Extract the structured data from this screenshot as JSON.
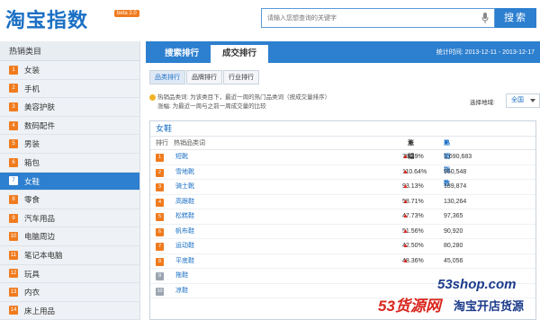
{
  "header": {
    "logo": "淘宝指数",
    "beta": "beta 2.0",
    "search_placeholder": "请输入您想查询的关键字",
    "search_button": "搜索"
  },
  "sidebar": {
    "title": "热销类目",
    "items": [
      {
        "num": "1",
        "label": "女装"
      },
      {
        "num": "2",
        "label": "手机"
      },
      {
        "num": "3",
        "label": "美容护肤"
      },
      {
        "num": "4",
        "label": "数码配件"
      },
      {
        "num": "5",
        "label": "男装"
      },
      {
        "num": "6",
        "label": "箱包"
      },
      {
        "num": "7",
        "label": "女鞋"
      },
      {
        "num": "8",
        "label": "零食"
      },
      {
        "num": "9",
        "label": "汽车用品"
      },
      {
        "num": "10",
        "label": "电脑周边"
      },
      {
        "num": "11",
        "label": "笔记本电脑"
      },
      {
        "num": "12",
        "label": "玩具"
      },
      {
        "num": "13",
        "label": "内衣"
      },
      {
        "num": "14",
        "label": "床上用品"
      }
    ],
    "active_index": 6
  },
  "main": {
    "tabs": [
      {
        "label": "搜索排行"
      },
      {
        "label": "成交排行"
      }
    ],
    "stat_time": "统计时间: 2013-12-11 - 2013-12-17",
    "subtabs": [
      {
        "label": "品类排行"
      },
      {
        "label": "品牌排行"
      },
      {
        "label": "行业排行"
      }
    ],
    "notes": {
      "line1": "热销品类词: 为该类目下，最近一周的热门品类词（按成交量排序）",
      "line2": "涨幅: 为最近一周与之前一周成交量的比较"
    },
    "region_label": "选择地域:",
    "region_value": "全国",
    "panel": {
      "title": "女鞋",
      "col_rank": "排行",
      "col_category": "热销品类词",
      "col_rise": "涨幅",
      "col_index": "热销指数",
      "rows": [
        {
          "rank": "1",
          "name": "短靴",
          "rise": "78.39%",
          "index": "1,690,683"
        },
        {
          "rank": "2",
          "name": "雪地靴",
          "rise": "110.64%",
          "index": "950,548"
        },
        {
          "rank": "3",
          "name": "骑士靴",
          "rise": "93.13%",
          "index": "189,874"
        },
        {
          "rank": "4",
          "name": "高跟鞋",
          "rise": "58.71%",
          "index": "130,264"
        },
        {
          "rank": "5",
          "name": "松糕鞋",
          "rise": "47.73%",
          "index": "97,365"
        },
        {
          "rank": "6",
          "name": "帆布鞋",
          "rise": "51.56%",
          "index": "90,920"
        },
        {
          "rank": "7",
          "name": "运动鞋",
          "rise": "42.50%",
          "index": "80,280"
        },
        {
          "rank": "8",
          "name": "平底鞋",
          "rise": "48.36%",
          "index": "45,056"
        },
        {
          "rank": "9",
          "name": "拖鞋",
          "rise": "",
          "index": ""
        },
        {
          "rank": "10",
          "name": "凉鞋",
          "rise": "",
          "index": ""
        }
      ]
    }
  },
  "watermark": {
    "site": "53shop.com",
    "brand": "53货源网",
    "slogan": "淘宝开店货源"
  },
  "colors": {
    "accent_blue": "#2d7fcf",
    "rank_orange": "#f07b1e",
    "rise_red": "#d9251c"
  }
}
